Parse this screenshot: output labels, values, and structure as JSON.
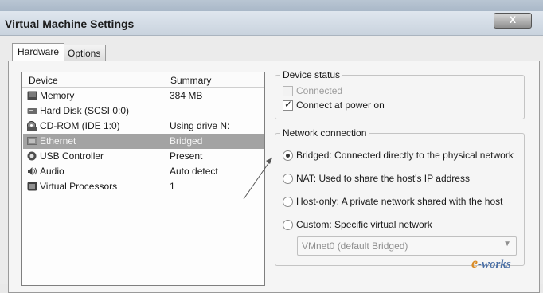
{
  "window": {
    "title": "Virtual Machine Settings",
    "close_glyph": "X"
  },
  "tabs": [
    {
      "label": "Hardware",
      "active": true
    },
    {
      "label": "Options",
      "active": false
    }
  ],
  "device_list": {
    "headers": {
      "device": "Device",
      "summary": "Summary"
    },
    "rows": [
      {
        "icon": "memory-icon",
        "device": "Memory",
        "summary": "384 MB"
      },
      {
        "icon": "hard-disk-icon",
        "device": "Hard Disk (SCSI 0:0)",
        "summary": ""
      },
      {
        "icon": "cd-rom-icon",
        "device": "CD-ROM (IDE 1:0)",
        "summary": "Using drive N:"
      },
      {
        "icon": "ethernet-icon",
        "device": "Ethernet",
        "summary": "Bridged",
        "selected": true
      },
      {
        "icon": "usb-icon",
        "device": "USB Controller",
        "summary": "Present"
      },
      {
        "icon": "audio-icon",
        "device": "Audio",
        "summary": "Auto detect"
      },
      {
        "icon": "processor-icon",
        "device": "Virtual Processors",
        "summary": "1"
      }
    ]
  },
  "device_status": {
    "legend": "Device status",
    "connected": {
      "label": "Connected",
      "checked": false,
      "enabled": false
    },
    "connect_at_power_on": {
      "label": "Connect at power on",
      "checked": true,
      "enabled": true
    }
  },
  "network_connection": {
    "legend": "Network connection",
    "options": [
      {
        "label": "Bridged: Connected directly to the physical network",
        "selected": true
      },
      {
        "label": "NAT: Used to share the host's IP address",
        "selected": false
      },
      {
        "label": "Host-only: A private network shared with the host",
        "selected": false
      },
      {
        "label": "Custom: Specific virtual network",
        "selected": false
      }
    ],
    "custom_select": {
      "value": "VMnet0 (default Bridged)",
      "enabled": false
    }
  },
  "watermark": {
    "logo_prefix": "e",
    "logo_suffix": "-works"
  }
}
